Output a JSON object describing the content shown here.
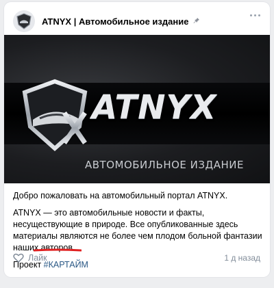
{
  "post": {
    "author": "ATNYX | Автомобильное издание",
    "banner": {
      "logo_text": "ATNYX",
      "logo_subtitle": "АВТОМОБИЛЬНОЕ ИЗДАНИЕ"
    },
    "paragraphs": [
      "Добро пожаловать на автомобильный портал ATNYX.",
      "ATNYX — это автомобильные новости и факты, несуществующие в природе. Все опубликованные здесь материалы являются не более чем плодом больной фантазии наших авторов."
    ],
    "project_label": "Проект",
    "hashtag": "#КАРТАЙМ",
    "like_label": "Лайк",
    "time": "1 д назад"
  },
  "colors": {
    "link": "#2a5885",
    "muted": "#818c99",
    "annotation_red": "#e02020"
  },
  "icons": [
    "pin-icon",
    "more-icon",
    "heart-icon",
    "shield-car-logo"
  ]
}
